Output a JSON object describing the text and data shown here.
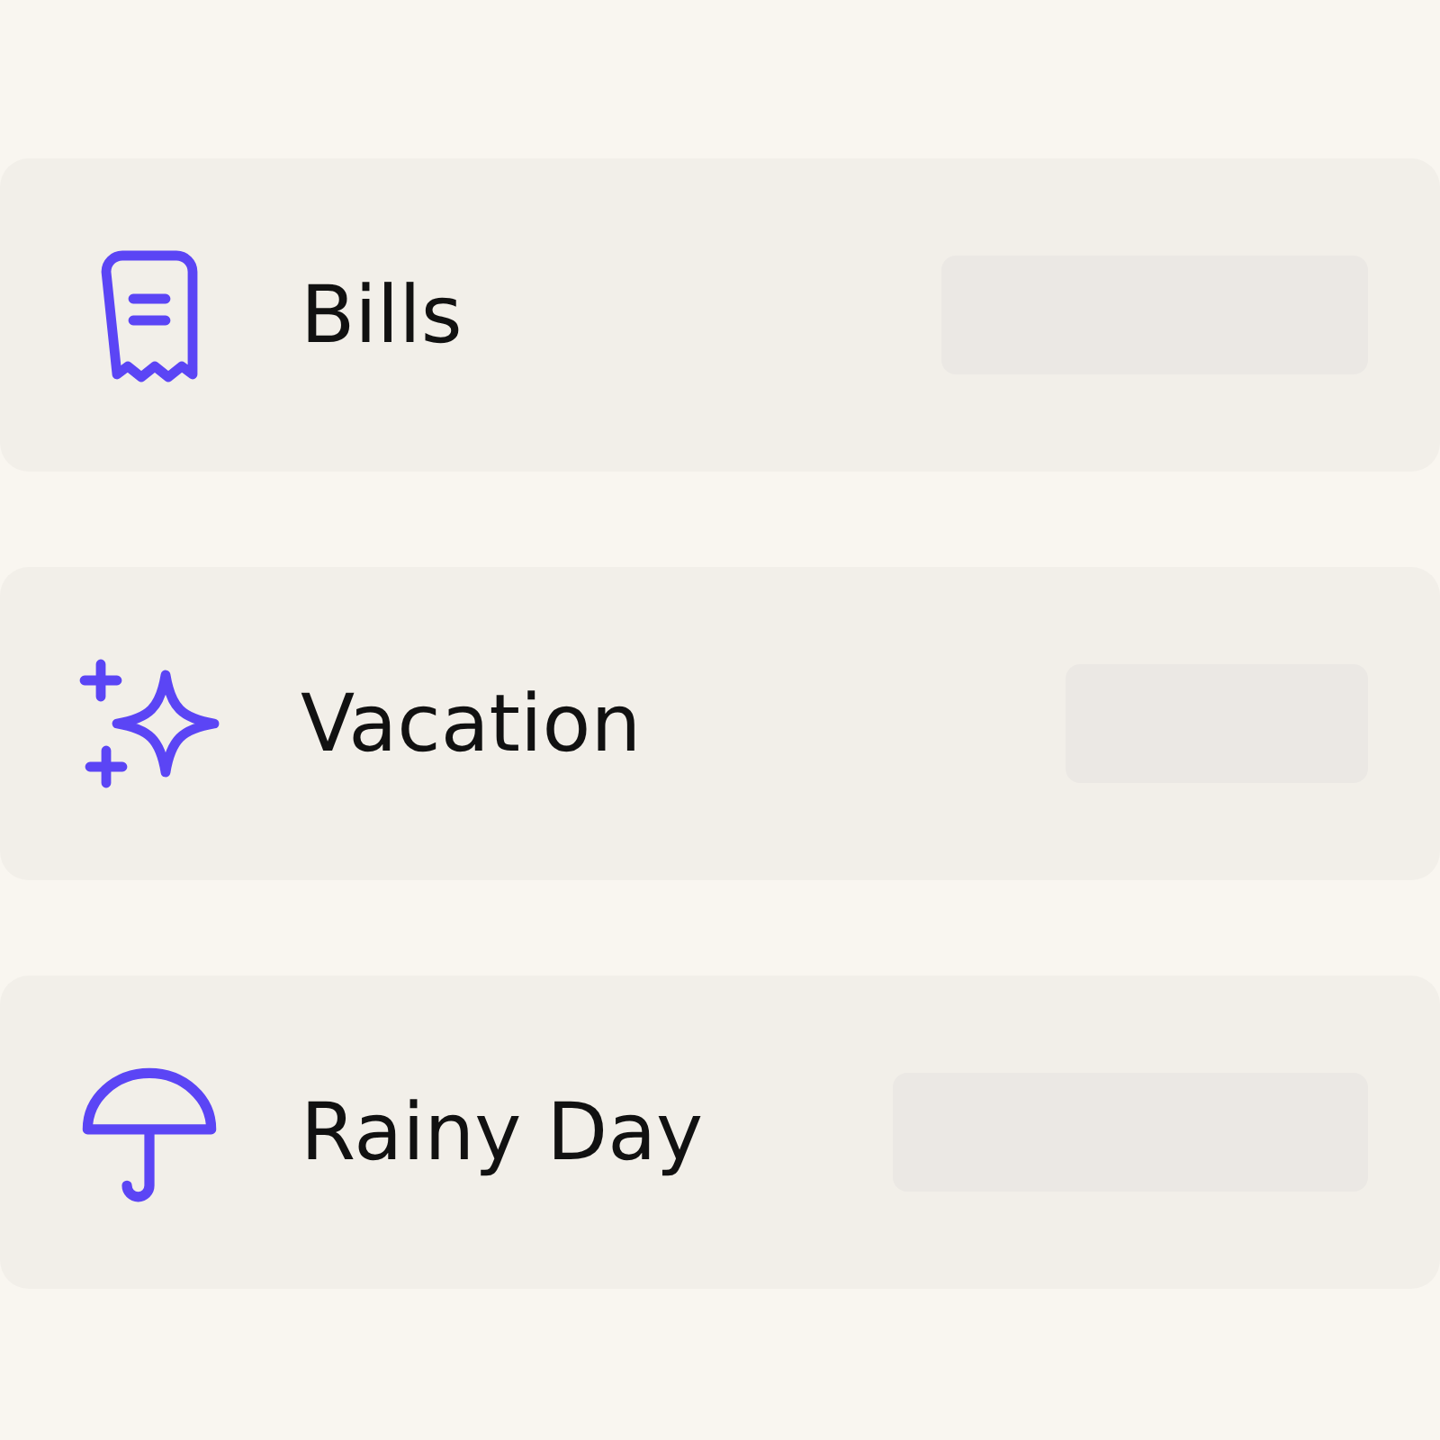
{
  "savings_goals": [
    {
      "name": "Bills"
    },
    {
      "name": "Vacation"
    },
    {
      "name": "Rainy Day"
    }
  ]
}
